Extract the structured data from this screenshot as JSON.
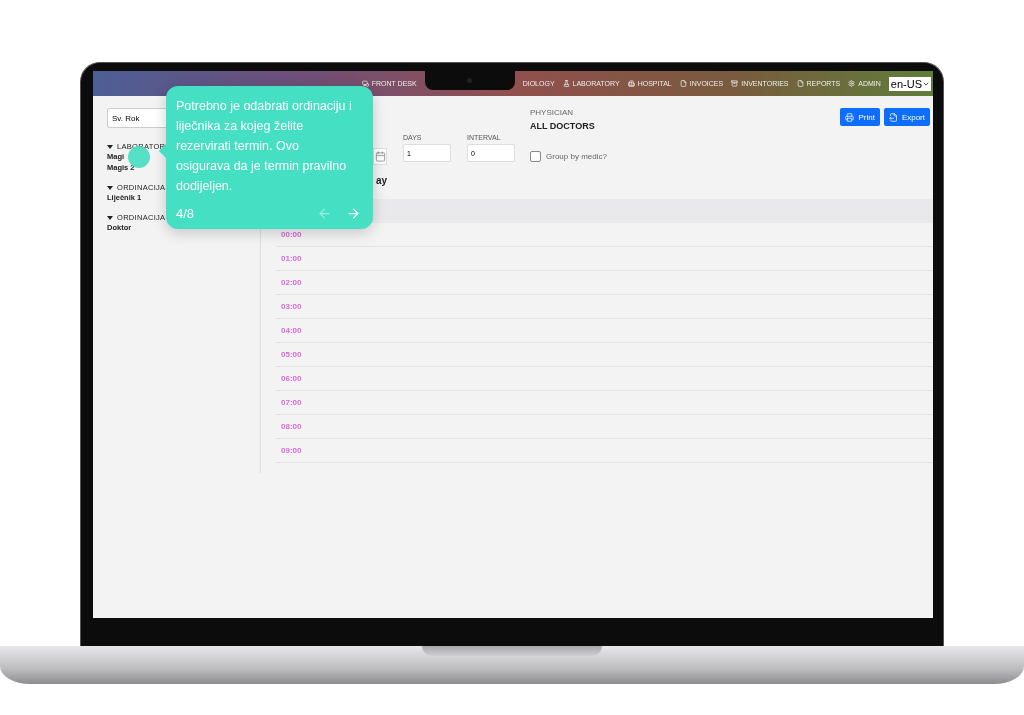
{
  "nav": {
    "items": [
      {
        "label": "FRONT DESK",
        "kind": "desk"
      },
      {
        "label": "DIOLOGY",
        "kind": "plain"
      },
      {
        "label": "LABORATORY",
        "kind": "lab"
      },
      {
        "label": "HOSPITAL",
        "kind": "hospital"
      },
      {
        "label": "INVOICES",
        "kind": "file"
      },
      {
        "label": "INVENTORIES",
        "kind": "bin"
      },
      {
        "label": "REPORTS",
        "kind": "file"
      },
      {
        "label": "ADMIN",
        "kind": "gear"
      }
    ],
    "language": "en-US"
  },
  "sidebar": {
    "search": {
      "value": "Sv. Rok"
    },
    "groups": [
      {
        "label": "LABORATOR",
        "expanded": true,
        "items": [
          "Magi",
          "Magis 2"
        ]
      },
      {
        "label": "ORDINACIJA",
        "expanded": true,
        "items": [
          "Liječnik 1"
        ]
      },
      {
        "label": "ORDINACIJA",
        "expanded": true,
        "items": [
          "Doktor"
        ]
      }
    ]
  },
  "filters": {
    "days": {
      "label": "DAYS",
      "value": "1"
    },
    "interval": {
      "label": "INTERVAL",
      "value": "0"
    },
    "physician": {
      "label": "PHYSICIAN",
      "value": "ALL DOCTORS"
    },
    "group_by_medic": {
      "label": "Group by medic?",
      "checked": false
    }
  },
  "actions": [
    {
      "label": "Print",
      "kind": "print"
    },
    {
      "label": "Export",
      "kind": "export"
    }
  ],
  "schedule": {
    "heading": "ay",
    "times": [
      "00:00",
      "01:00",
      "02:00",
      "03:00",
      "04:00",
      "05:00",
      "06:00",
      "07:00",
      "08:00",
      "09:00"
    ]
  },
  "tour": {
    "text": "Potrebno je odabrati ordinaciju i liječnika za kojeg želite rezervirati termin. Ovo osigurava da je termin pravilno dodijeljen.",
    "counter": "4/8",
    "back_disabled": true
  }
}
